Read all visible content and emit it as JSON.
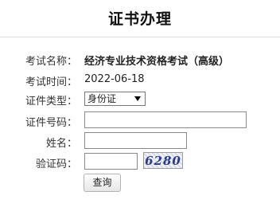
{
  "header": {
    "title": "证书办理"
  },
  "form": {
    "exam_name": {
      "label": "考试名称：",
      "value": "经济专业技术资格考试（高级）"
    },
    "exam_time": {
      "label": "考试时间：",
      "value": "2022-06-18"
    },
    "id_type": {
      "label": "证件类型：",
      "selected": "身份证"
    },
    "id_number": {
      "label": "证件号码：",
      "value": ""
    },
    "name": {
      "label": "姓名：",
      "value": ""
    },
    "captcha": {
      "label": "验证码：",
      "value": "",
      "image_text": "6280"
    },
    "submit_label": "查询"
  },
  "colors": {
    "captcha_text": "#2b3a8c",
    "divider": "#e3e3e3"
  }
}
